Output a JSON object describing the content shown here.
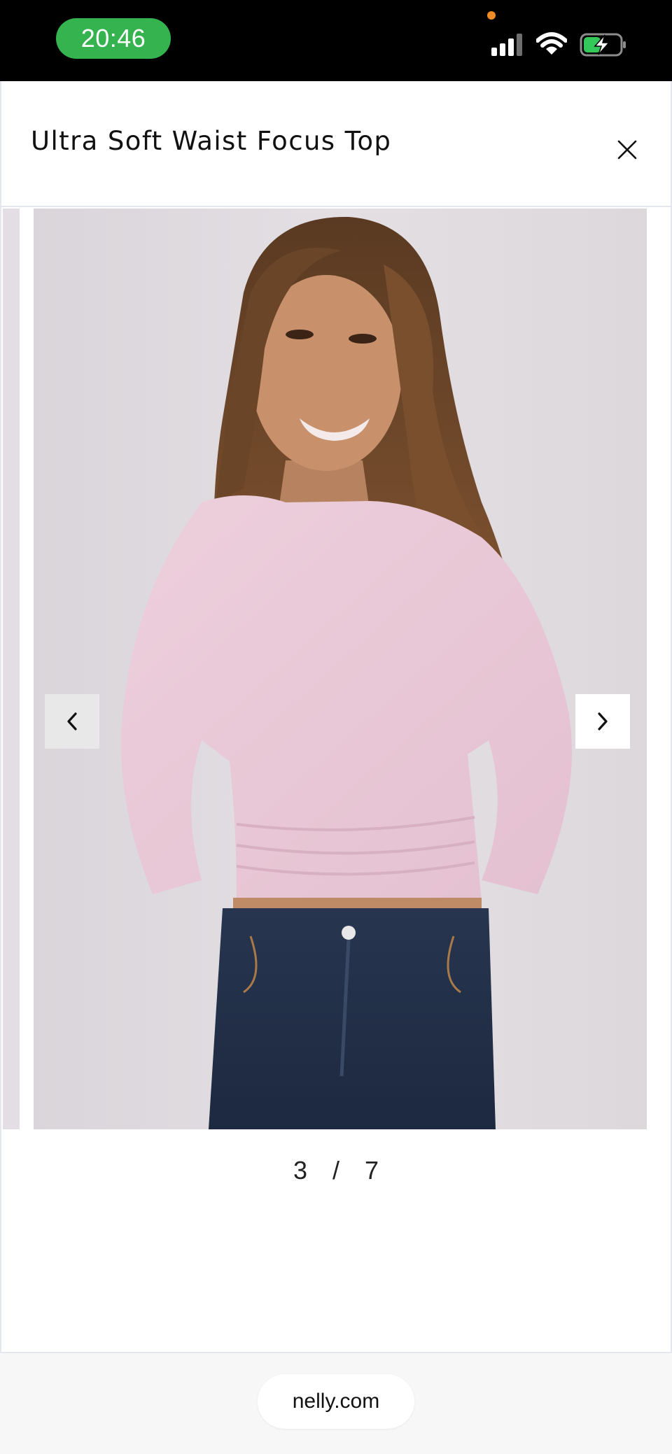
{
  "status_bar": {
    "time": "20:46",
    "icons": [
      "signal-icon",
      "wifi-icon",
      "battery-charging-icon"
    ],
    "time_pill_color": "#34b34e"
  },
  "modal": {
    "title": "Ultra Soft Waist Focus Top",
    "close_icon": "close-icon"
  },
  "gallery": {
    "current": "3",
    "separator": "/",
    "total": "7",
    "prev_icon": "chevron-left-icon",
    "next_icon": "chevron-right-icon"
  },
  "browser": {
    "url": "nelly.com"
  }
}
